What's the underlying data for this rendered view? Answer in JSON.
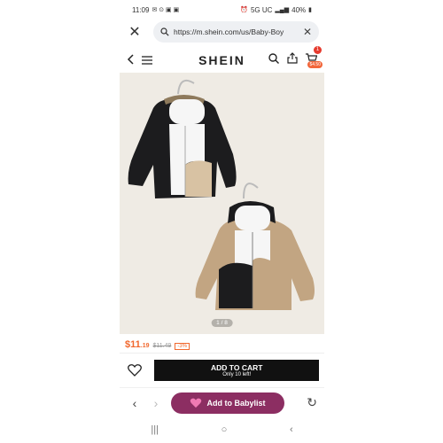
{
  "status_bar": {
    "time": "11:09",
    "network": "5G UC",
    "battery": "40%"
  },
  "browser": {
    "url": "https://m.shein.com/us/Baby-Boy"
  },
  "site": {
    "logo": "SHEIN",
    "cart_count": "1",
    "cart_amount": "$4.50"
  },
  "product": {
    "pager": "1 / 8"
  },
  "price": {
    "dollar": "$11",
    "cents": ".19",
    "original": "$11.49",
    "discount": "-3%"
  },
  "cart_button": {
    "label": "ADD TO CART",
    "stock_note": "Only 10 left!"
  },
  "babylist": {
    "label": "Add to Babylist"
  },
  "colors": {
    "price": "#f1682e",
    "babylist_bg": "#8c2e62",
    "atc_bg": "#111111",
    "jacket_black": "#1c1c1e",
    "jacket_tan": "#c2a582"
  },
  "icons": [
    "close-icon",
    "search-icon",
    "back-icon",
    "menu-icon",
    "share-icon",
    "cart-icon",
    "heart-icon",
    "reload-icon"
  ]
}
